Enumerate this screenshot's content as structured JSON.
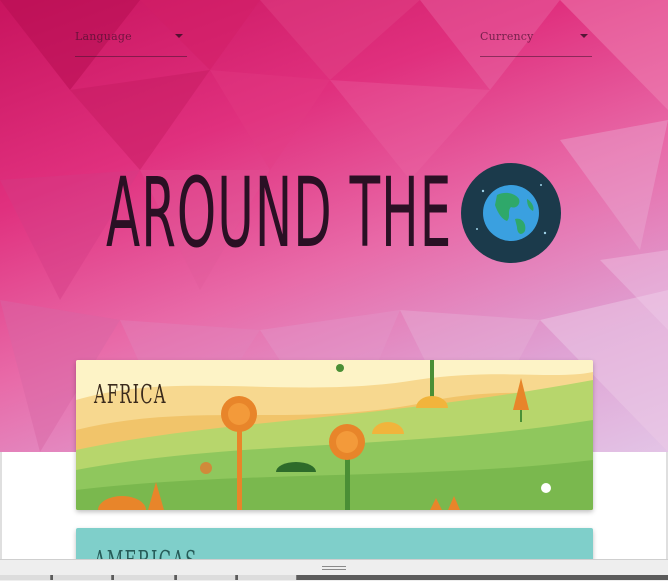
{
  "header": {
    "language": {
      "label": "Language"
    },
    "currency": {
      "label": "Currency"
    }
  },
  "hero": {
    "title": "AROUND THE",
    "logo_icon": "globe-icon"
  },
  "cards": [
    {
      "title": "AFRICA",
      "image_icon": "savanna-landscape"
    },
    {
      "title": "AMERICAS"
    }
  ],
  "colors": {
    "hero_start": "#c8145e",
    "hero_end": "#e3c4e6",
    "title_text": "#2a1024",
    "globe_ring": "#1b3a4b",
    "globe_ocean": "#3aa0e0",
    "globe_land": "#2fa86a",
    "africa_meadow": "#8fc75d",
    "americas_bg": "#7fcfca"
  }
}
